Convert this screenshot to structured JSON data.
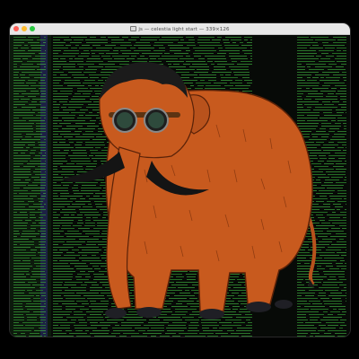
{
  "window": {
    "title": "js — celestia light start — 339×126",
    "controls": [
      "close",
      "minimize",
      "zoom"
    ]
  },
  "terminal": {
    "content": "scrolling green log output (illegible)",
    "foreground_color": "#3aa23a",
    "background_color": "#070a07"
  },
  "artwork": {
    "subject": "cartoon woolly mammoth wearing goggles",
    "fur_color": "#c85a1e",
    "hair_color": "#1b1b1b",
    "tusk_color": "#141414",
    "goggle_lens_color": "#2e4a3c"
  }
}
